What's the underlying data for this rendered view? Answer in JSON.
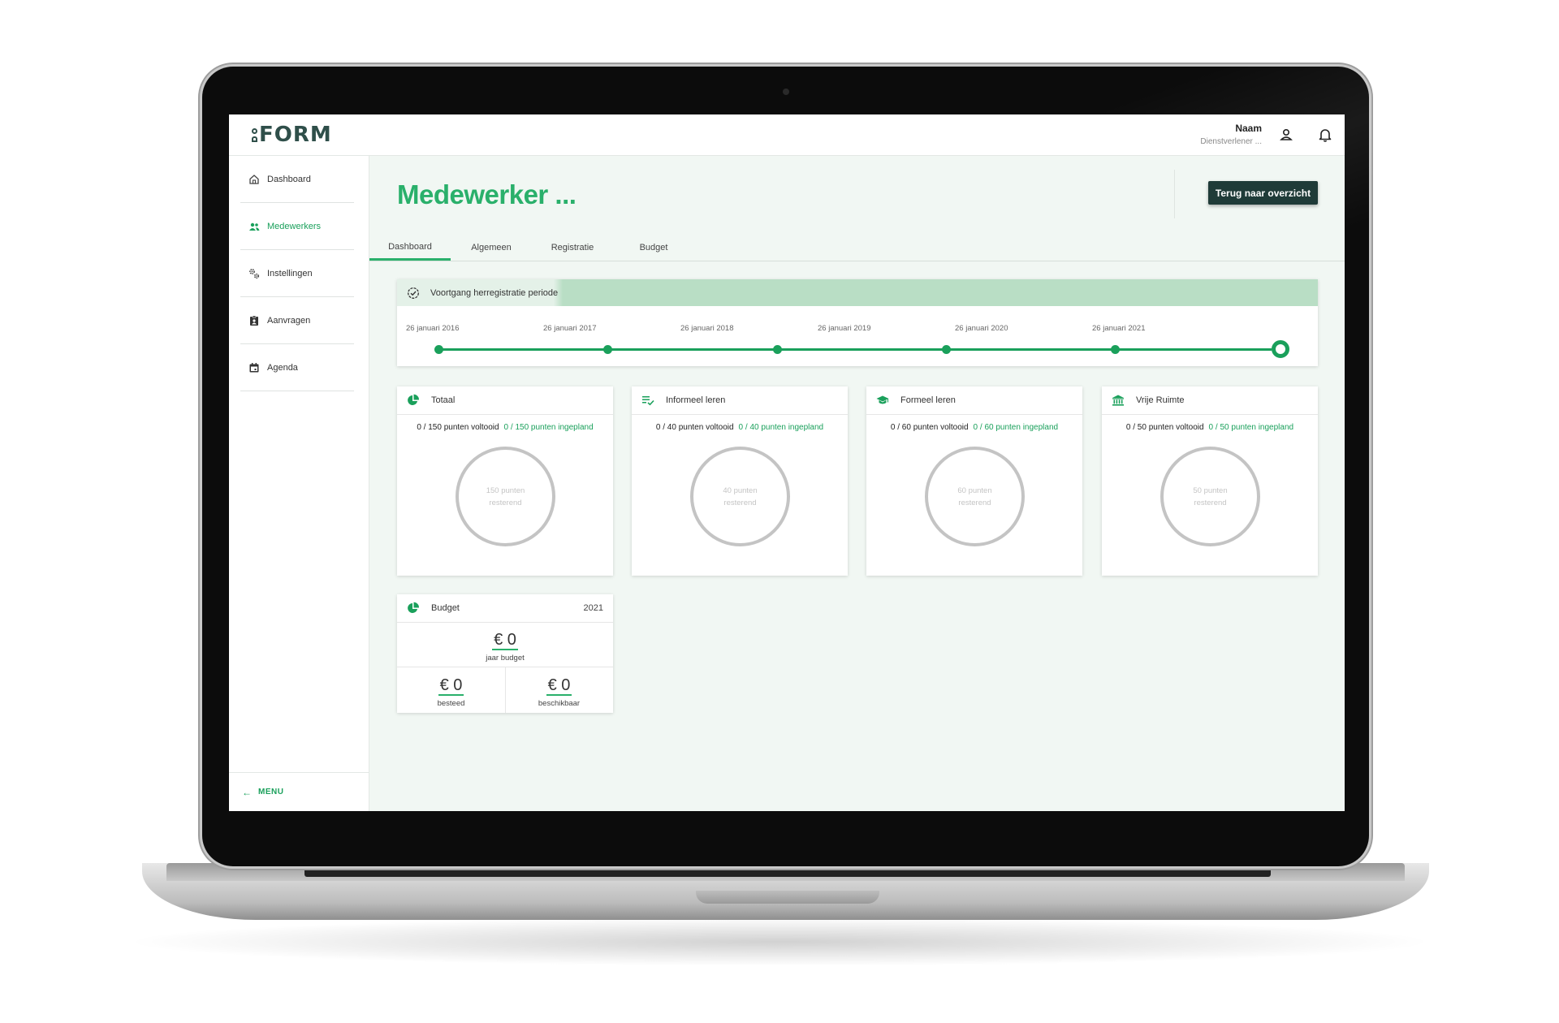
{
  "app": {
    "logo_text": "FORM"
  },
  "user": {
    "name": "Naam",
    "role": "Dienstverlener ..."
  },
  "sidebar": {
    "items": [
      {
        "label": "Dashboard",
        "icon": "home-icon"
      },
      {
        "label": "Medewerkers",
        "icon": "users-icon",
        "active": true
      },
      {
        "label": "Instellingen",
        "icon": "gears-icon"
      },
      {
        "label": "Aanvragen",
        "icon": "clipboard-user-icon"
      },
      {
        "label": "Agenda",
        "icon": "calendar-icon"
      }
    ],
    "menu_label": "MENU"
  },
  "page": {
    "title": "Medewerker ...",
    "back_button": "Terug naar overzicht"
  },
  "tabs": [
    "Dashboard",
    "Algemeen",
    "Registratie",
    "Budget"
  ],
  "active_tab": "Dashboard",
  "progress": {
    "title": "Voortgang herregistratie periode",
    "dates": [
      "26 januari 2016",
      "26 januari 2017",
      "26 januari 2018",
      "26 januari 2019",
      "26 januari 2020",
      "26 januari 2021"
    ],
    "current_index": 5
  },
  "cards": [
    {
      "title": "Totaal",
      "icon": "pie-chart-icon",
      "completed": "0 / 150 punten voltooid",
      "planned": "0 / 150 punten ingepland",
      "remaining_value": "150 punten",
      "remaining_label": "resterend"
    },
    {
      "title": "Informeel leren",
      "icon": "list-check-icon",
      "completed": "0 / 40 punten voltooid",
      "planned": "0 / 40 punten ingepland",
      "remaining_value": "40 punten",
      "remaining_label": "resterend"
    },
    {
      "title": "Formeel leren",
      "icon": "graduation-cap-icon",
      "completed": "0 / 60 punten voltooid",
      "planned": "0 / 60 punten ingepland",
      "remaining_value": "60 punten",
      "remaining_label": "resterend"
    },
    {
      "title": "Vrije Ruimte",
      "icon": "bank-icon",
      "completed": "0 / 50 punten voltooid",
      "planned": "0 / 50 punten ingepland",
      "remaining_value": "50 punten",
      "remaining_label": "resterend"
    }
  ],
  "budget": {
    "title": "Budget",
    "year": "2021",
    "year_budget": {
      "amount": "€ 0",
      "label": "jaar budget"
    },
    "spent": {
      "amount": "€ 0",
      "label": "besteed"
    },
    "available": {
      "amount": "€ 0",
      "label": "beschikbaar"
    }
  },
  "colors": {
    "accent": "#2ab06b",
    "dark_button": "#1f3b38",
    "background": "#f1f7f3",
    "progress_header": "#b9dec5"
  }
}
